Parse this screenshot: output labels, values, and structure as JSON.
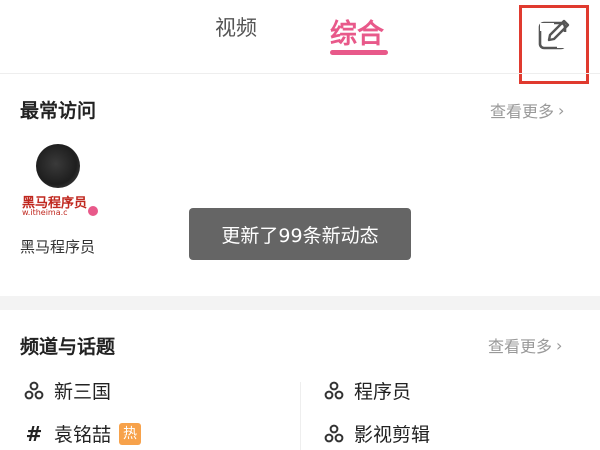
{
  "header": {
    "tabs": [
      {
        "label": "视频",
        "active": false
      },
      {
        "label": "综合",
        "active": true
      }
    ],
    "accent_color": "#e8598a",
    "edit_icon": "edit-icon"
  },
  "recent": {
    "title": "最常访问",
    "more_label": "查看更多",
    "items": [
      {
        "name": "黑马程序员",
        "avatar_brand": "黑马程序员",
        "avatar_url": "w.itheima.c"
      }
    ]
  },
  "toast": {
    "text": "更新了99条新动态"
  },
  "channels": {
    "title": "频道与话题",
    "more_label": "查看更多",
    "items": [
      {
        "label": "新三国",
        "icon": "channel-icon"
      },
      {
        "label": "程序员",
        "icon": "channel-icon"
      },
      {
        "label": "袁铭喆",
        "icon": "hashtag-icon",
        "badge": "热"
      },
      {
        "label": "影视剪辑",
        "icon": "channel-icon"
      }
    ],
    "badge_color": "#f7a24b"
  }
}
